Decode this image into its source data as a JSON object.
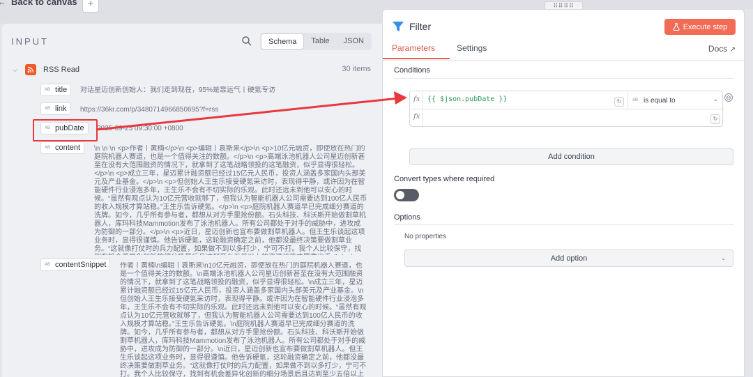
{
  "topbar": {
    "back_label": "Back to canvas",
    "back_arrow": "←",
    "add_symbol": "+",
    "drag_handle": "⠿⠿⠿⠿"
  },
  "input": {
    "title": "INPUT",
    "views": [
      "Schema",
      "Table",
      "JSON"
    ],
    "active_view": "Schema",
    "node": {
      "name": "RSS Read",
      "count_label": "30 items",
      "icon": "rss-icon"
    },
    "type_tag": "AB",
    "fields": [
      {
        "name": "title",
        "value": "对话星迈创新创始人：我们走到现在，95%是靠运气丨硬氪专访"
      },
      {
        "name": "link",
        "value": "https://36kr.com/p/3480714966850695?f=rss"
      },
      {
        "name": "pubDate",
        "value": "2025-09-25 09:30:00 +0800"
      },
      {
        "name": "content",
        "value": "\\n \\n \\n <p>作者丨黄楠</p>\\n <p>编辑丨袁斯来</p>\\n <p>10亿元融资，即使放在热门的庭院机器人赛道，也是一个值得关注的数额。</p>\\n <p>高端泳池机器人公司星迈创新甚至在没有大范围融资的情况下，就拿到了这笔战略领投的这笔融资，似乎显得很轻松。</p>\\n <p>成立三年，星迈累计融资额已经过15亿元人民币，投资人涵盖多家国内头部美元及产业基金。</p>\\n <p>但创始人王生乐接受硬氪采访时，表现得平静，或许因为在智能硬件行业浸泡多年，王生乐不会有不切实际的乐观。此时还远未到他可以安心的时候。“虽然有观点认为10亿元营收就够了，但我认为智能机器人公司需要达到100亿人民币的收入规模才算站稳。”王生乐告诉硬氪。</p>\\n <p>庭院机器人赛道早已完成细分赛道的洗牌。如今，几乎所有参与者，都想从对方手里抢份额。石头科技、科沃斯开始做割草机器人，库玛科技Mammotion发布了泳池机器人。所有公司都处于对手的威胁中，进攻成为防御的一部分。</p>\\n <p>近日，星迈创新也宣布要做割草机器人。但王生乐谈起这项业务时，显得很谨慎。他告诉硬氪，这轮融资确定之前，他都没最终决策要做割草业务。“这就像打仗时的兵力配置，如果做不到以多打少，宁可不打。我个人比较保守，找到有机会差异化创新的细分场景后且达到至少五倍以上的资源优势才愿意出手。”</p>\\n <p>..."
      },
      {
        "name": "contentSnippet",
        "value": "作者丨黄楠\\n编辑丨袁斯来\\n10亿元融资，即使放在热门的庭院机器人赛道，也是一个值得关注的数额。\\n高端泳池机器人公司星迈创新甚至在没有大范围融资的情况下，就拿到了这笔战略领投的融资，似乎显得很轻松。\\n成立三年，星迈累计融资额已经过15亿元人民币，投资人涵盖多家国内头部美元及产业基金。\\n但创始人王生乐接受硬氪采访时，表现得平静。或许因为在智能硬件行业浸泡多年，王生乐不会有不切实际的乐观。此时还远未到他可以安心的时候。“虽然有观点认为10亿元营收就够了，但我认为智能机器人公司需要达到100亿人民币的收入规模才算站稳。”王生乐告诉硬氪。\\n庭院机器人赛道早已完成细分赛道的洗牌。如今，几乎所有参与者，都想从对方手里抢份额。石头科技、科沃斯开始做割草机器人，库玛科技Mammotion发布了泳池机器人。所有公司都处于对手的威胁中，进攻成为防御的一部分。\\n近日，星迈创新也宣布要做割草机器人。但王生乐谈起这项业务时，显得很谨慎。他告诉硬氪，这轮融资确定之前，他都没最终决策要做割草业务。“这就像打仗时的兵力配置，如果做不到以多打少，宁可不打。我个人比较保守，找到有机会差异化创新的细分场景后且达到至少五倍以上的资源优势才愿意出手。”\\n所以星迈创新并不会上场就开始冲刺，而是先做深细分人群。“我们推出割草机器人，不"
      }
    ]
  },
  "filter": {
    "title": "Filter",
    "execute_label": "Execute step",
    "tabs": [
      "Parameters",
      "Settings"
    ],
    "active_tab": "Parameters",
    "docs_label": "Docs",
    "docs_icon": "↗",
    "conditions_label": "Conditions",
    "fx_label": "fx",
    "left_value": "{{ $json.pubDate }}",
    "operator_tag": "AB",
    "operator": "is equal to",
    "right_value": "",
    "reset_symbol": "↻",
    "remove_symbol": "⊖",
    "add_condition_label": "Add condition",
    "convert_label": "Convert types where required",
    "convert_enabled": false,
    "options_label": "Options",
    "no_properties_label": "No properties",
    "add_option_label": "Add option",
    "chevron_symbol": "⌄"
  },
  "annotation": {
    "color": "#e8383d"
  }
}
